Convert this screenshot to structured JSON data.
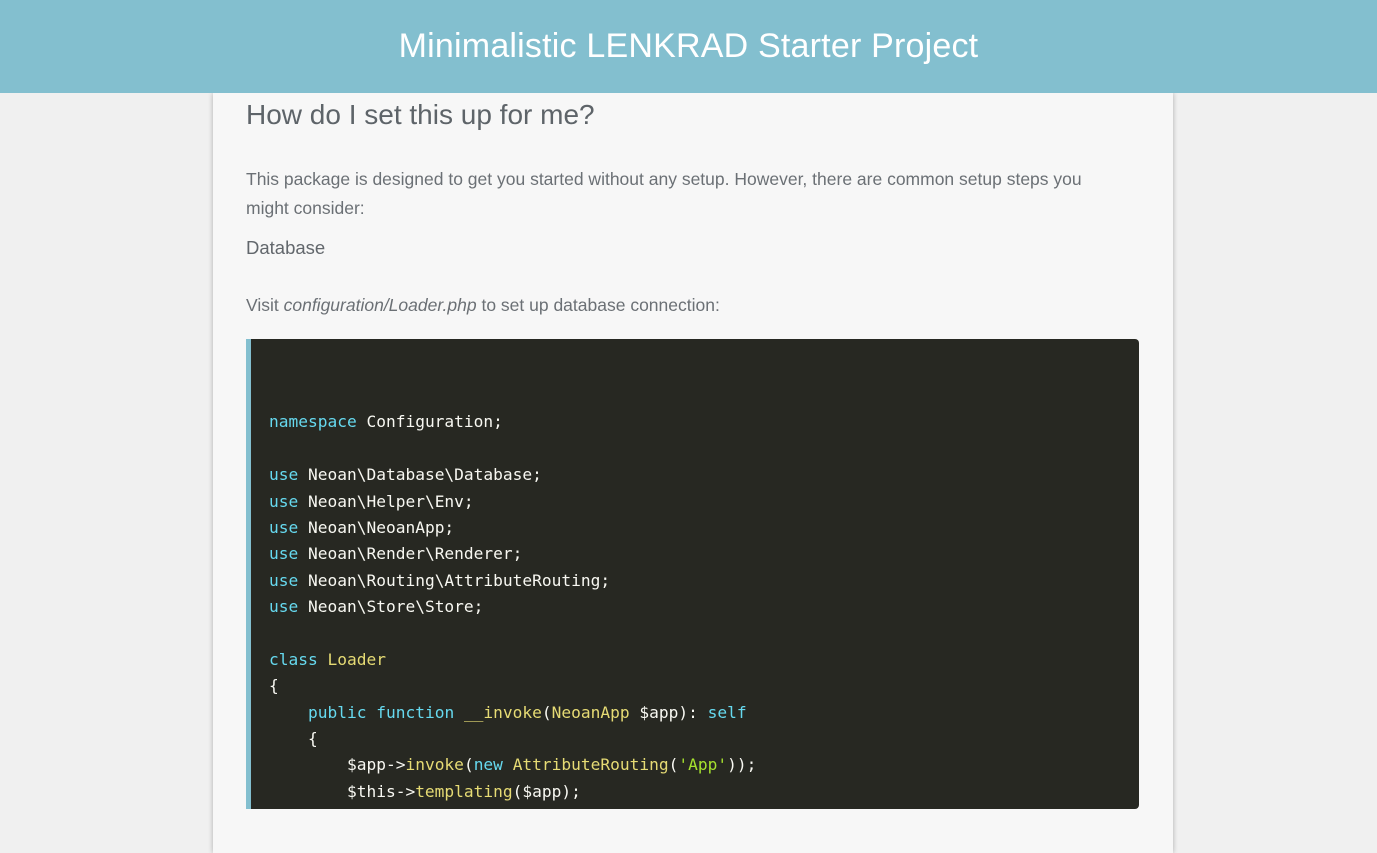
{
  "header": {
    "title": "Minimalistic LENKRAD Starter Project"
  },
  "content": {
    "section_title": "How do I set this up for me?",
    "intro": "This package is designed to get you started without any setup. However, there are common setup steps you might consider:",
    "subheading": "Database",
    "visit_prefix": "Visit ",
    "visit_path": "configuration/Loader.php",
    "visit_suffix": " to set up database connection:"
  },
  "code": {
    "lines": [
      [],
      [
        {
          "t": "namespace",
          "c": "kw"
        },
        {
          "t": " Configuration;",
          "c": ""
        }
      ],
      [],
      [
        {
          "t": "use",
          "c": "kw"
        },
        {
          "t": " Neoan\\Database\\Database;",
          "c": ""
        }
      ],
      [
        {
          "t": "use",
          "c": "kw"
        },
        {
          "t": " Neoan\\Helper\\Env;",
          "c": ""
        }
      ],
      [
        {
          "t": "use",
          "c": "kw"
        },
        {
          "t": " Neoan\\NeoanApp;",
          "c": ""
        }
      ],
      [
        {
          "t": "use",
          "c": "kw"
        },
        {
          "t": " Neoan\\Render\\Renderer;",
          "c": ""
        }
      ],
      [
        {
          "t": "use",
          "c": "kw"
        },
        {
          "t": " Neoan\\Routing\\AttributeRouting;",
          "c": ""
        }
      ],
      [
        {
          "t": "use",
          "c": "kw"
        },
        {
          "t": " Neoan\\Store\\Store;",
          "c": ""
        }
      ],
      [],
      [
        {
          "t": "class",
          "c": "kw"
        },
        {
          "t": " ",
          "c": ""
        },
        {
          "t": "Loader",
          "c": "cls"
        }
      ],
      [
        {
          "t": "{",
          "c": ""
        }
      ],
      [
        {
          "t": "    ",
          "c": ""
        },
        {
          "t": "public",
          "c": "kw"
        },
        {
          "t": " ",
          "c": ""
        },
        {
          "t": "function",
          "c": "kw"
        },
        {
          "t": " ",
          "c": ""
        },
        {
          "t": "__invoke",
          "c": "fn"
        },
        {
          "t": "(",
          "c": ""
        },
        {
          "t": "NeoanApp",
          "c": "cls"
        },
        {
          "t": " $app): ",
          "c": ""
        },
        {
          "t": "self",
          "c": "kw"
        }
      ],
      [
        {
          "t": "    {",
          "c": ""
        }
      ],
      [
        {
          "t": "        $app->",
          "c": ""
        },
        {
          "t": "invoke",
          "c": "fn"
        },
        {
          "t": "(",
          "c": ""
        },
        {
          "t": "new",
          "c": "kw"
        },
        {
          "t": " ",
          "c": ""
        },
        {
          "t": "AttributeRouting",
          "c": "cls"
        },
        {
          "t": "(",
          "c": ""
        },
        {
          "t": "'App'",
          "c": "str"
        },
        {
          "t": "));",
          "c": ""
        }
      ],
      [
        {
          "t": "        $this->",
          "c": ""
        },
        {
          "t": "templating",
          "c": "fn"
        },
        {
          "t": "($app);",
          "c": ""
        }
      ]
    ]
  },
  "colors": {
    "header_bg": "#83bfcf",
    "code_bg": "#272822",
    "keyword": "#66d9ef",
    "class_name": "#e6db74",
    "string": "#a6e22e"
  }
}
